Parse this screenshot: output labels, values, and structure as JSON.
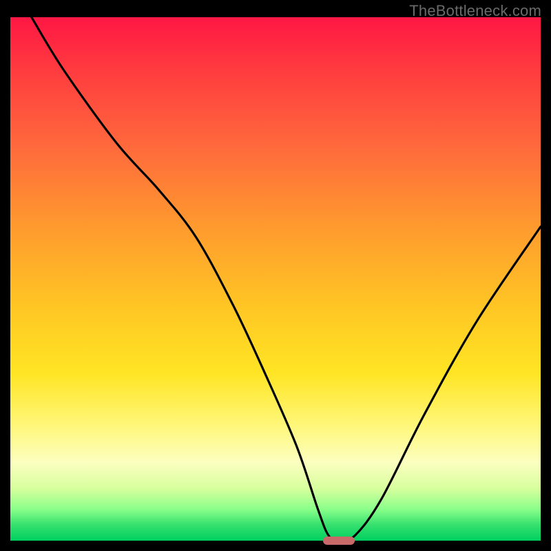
{
  "watermark": "TheBottleneck.com",
  "chart_data": {
    "type": "line",
    "title": "",
    "xlabel": "",
    "ylabel": "",
    "xlim": [
      0,
      100
    ],
    "ylim": [
      0,
      100
    ],
    "x": [
      4,
      10,
      20,
      28,
      35,
      42,
      48,
      54,
      58,
      60,
      62,
      65,
      70,
      78,
      88,
      100
    ],
    "values": [
      100,
      90,
      76,
      67,
      58,
      45,
      32,
      18,
      6,
      1,
      0,
      1,
      8,
      24,
      42,
      60
    ],
    "optimum_x": 62,
    "gradient_bands": [
      {
        "pos": 0,
        "color": "#ff1744"
      },
      {
        "pos": 25,
        "color": "#ff6a3c"
      },
      {
        "pos": 55,
        "color": "#ffc524"
      },
      {
        "pos": 78,
        "color": "#fff77a"
      },
      {
        "pos": 94,
        "color": "#8aff8a"
      },
      {
        "pos": 100,
        "color": "#00d060"
      }
    ],
    "marker": {
      "x": 62,
      "y": 0,
      "width_pct": 6,
      "height_pct": 1.6,
      "color": "#c96a6a"
    }
  }
}
